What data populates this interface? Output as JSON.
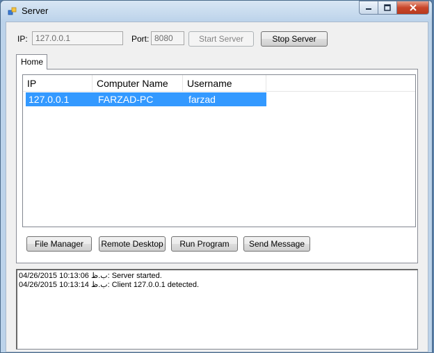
{
  "window": {
    "title": "Server"
  },
  "connection": {
    "ip_label": "IP:",
    "ip_value": "127.0.0.1",
    "port_label": "Port:",
    "port_value": "8080",
    "start_button": "Start Server",
    "stop_button": "Stop Server"
  },
  "tabs": [
    {
      "label": "Home",
      "selected": true
    }
  ],
  "clients_table": {
    "columns": [
      "IP",
      "Computer Name",
      "Username"
    ],
    "rows": [
      {
        "ip": "127.0.0.1",
        "computer_name": "FARZAD-PC",
        "username": "farzad",
        "selected": true
      }
    ]
  },
  "actions": {
    "file_manager": "File Manager",
    "remote_desktop": "Remote Desktop",
    "run_program": "Run Program",
    "send_message": "Send Message"
  },
  "log": [
    "04/26/2015 10:13:06 ب.ظ: Server started.",
    "04/26/2015 10:13:14 ب.ظ: Client 127.0.0.1 detected."
  ],
  "icons": {
    "app": "app-window-icon",
    "minimize": "minimize-icon",
    "maximize": "maximize-icon",
    "close": "close-icon"
  },
  "colors": {
    "selection": "#3399ff",
    "close_button": "#c8462a"
  }
}
